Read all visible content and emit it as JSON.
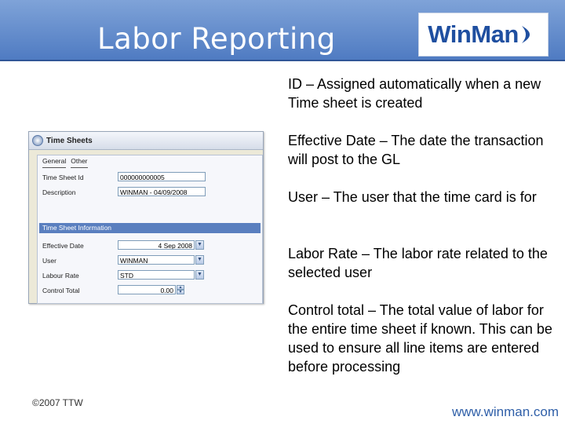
{
  "slide": {
    "title": "Labor Reporting",
    "logo_text": "WinMan",
    "descriptions": [
      "ID – Assigned automatically when a new Time sheet is created",
      "Effective Date – The date the transaction will post to the GL",
      "User – The user that the time card is for",
      "Labor Rate – The labor rate related to the selected user",
      "Control total – The total value of labor for the entire time sheet if known.  This can be used to ensure all line items are entered before processing"
    ],
    "copyright": "©2007 TTW",
    "url": "www.winman.com"
  },
  "window": {
    "title": "Time Sheets",
    "tabs": [
      "General",
      "Other"
    ],
    "labels": {
      "time_sheet_id": "Time Sheet Id",
      "description": "Description",
      "section": "Time Sheet Information",
      "effective_date": "Effective Date",
      "user": "User",
      "labor_rate": "Labour Rate",
      "control_total": "Control Total"
    },
    "values": {
      "time_sheet_id": "000000000005",
      "description": "WINMAN - 04/09/2008",
      "effective_date": "4 Sep 2008",
      "user": "WINMAN",
      "labor_rate": "STD",
      "control_total": "0.00"
    }
  }
}
